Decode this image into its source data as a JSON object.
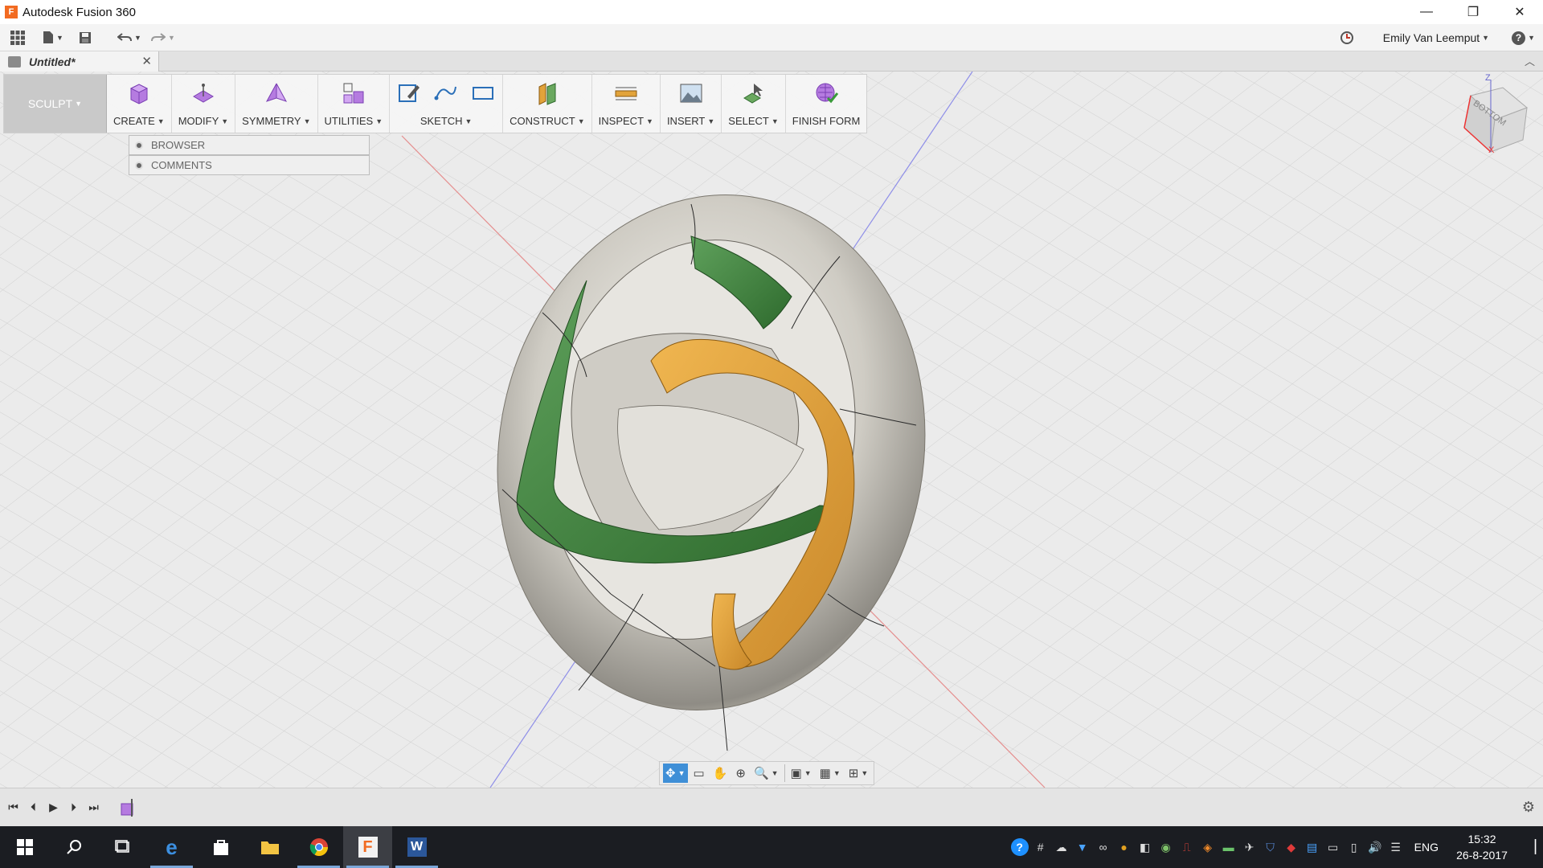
{
  "window": {
    "title": "Autodesk Fusion 360",
    "app_icon_letter": "F",
    "buttons": {
      "minimize": "—",
      "restore": "❐",
      "close": "✕"
    }
  },
  "quick_access": {
    "user_name": "Emily Van Leemput",
    "help": "?"
  },
  "document_tab": {
    "title": "Untitled*",
    "close": "✕"
  },
  "toolbar": {
    "workspace": "SCULPT",
    "groups": [
      {
        "label": "CREATE"
      },
      {
        "label": "MODIFY"
      },
      {
        "label": "SYMMETRY"
      },
      {
        "label": "UTILITIES"
      },
      {
        "label": "SKETCH"
      },
      {
        "label": "CONSTRUCT"
      },
      {
        "label": "INSPECT"
      },
      {
        "label": "INSERT"
      },
      {
        "label": "SELECT"
      },
      {
        "label": "FINISH FORM"
      }
    ]
  },
  "panels": {
    "browser": "BROWSER",
    "comments": "COMMENTS"
  },
  "viewcube": {
    "face": "BOTTOM",
    "axis_z": "Z",
    "axis_x": "X"
  },
  "taskbar": {
    "language": "ENG",
    "time": "15:32",
    "date": "26-8-2017"
  },
  "colors": {
    "accent_blue": "#3f8fd7",
    "form_green": "#3b7a3a",
    "form_orange": "#e2a33a",
    "form_silver": "#c8c6c0",
    "taskbar": "#1b1d22"
  }
}
